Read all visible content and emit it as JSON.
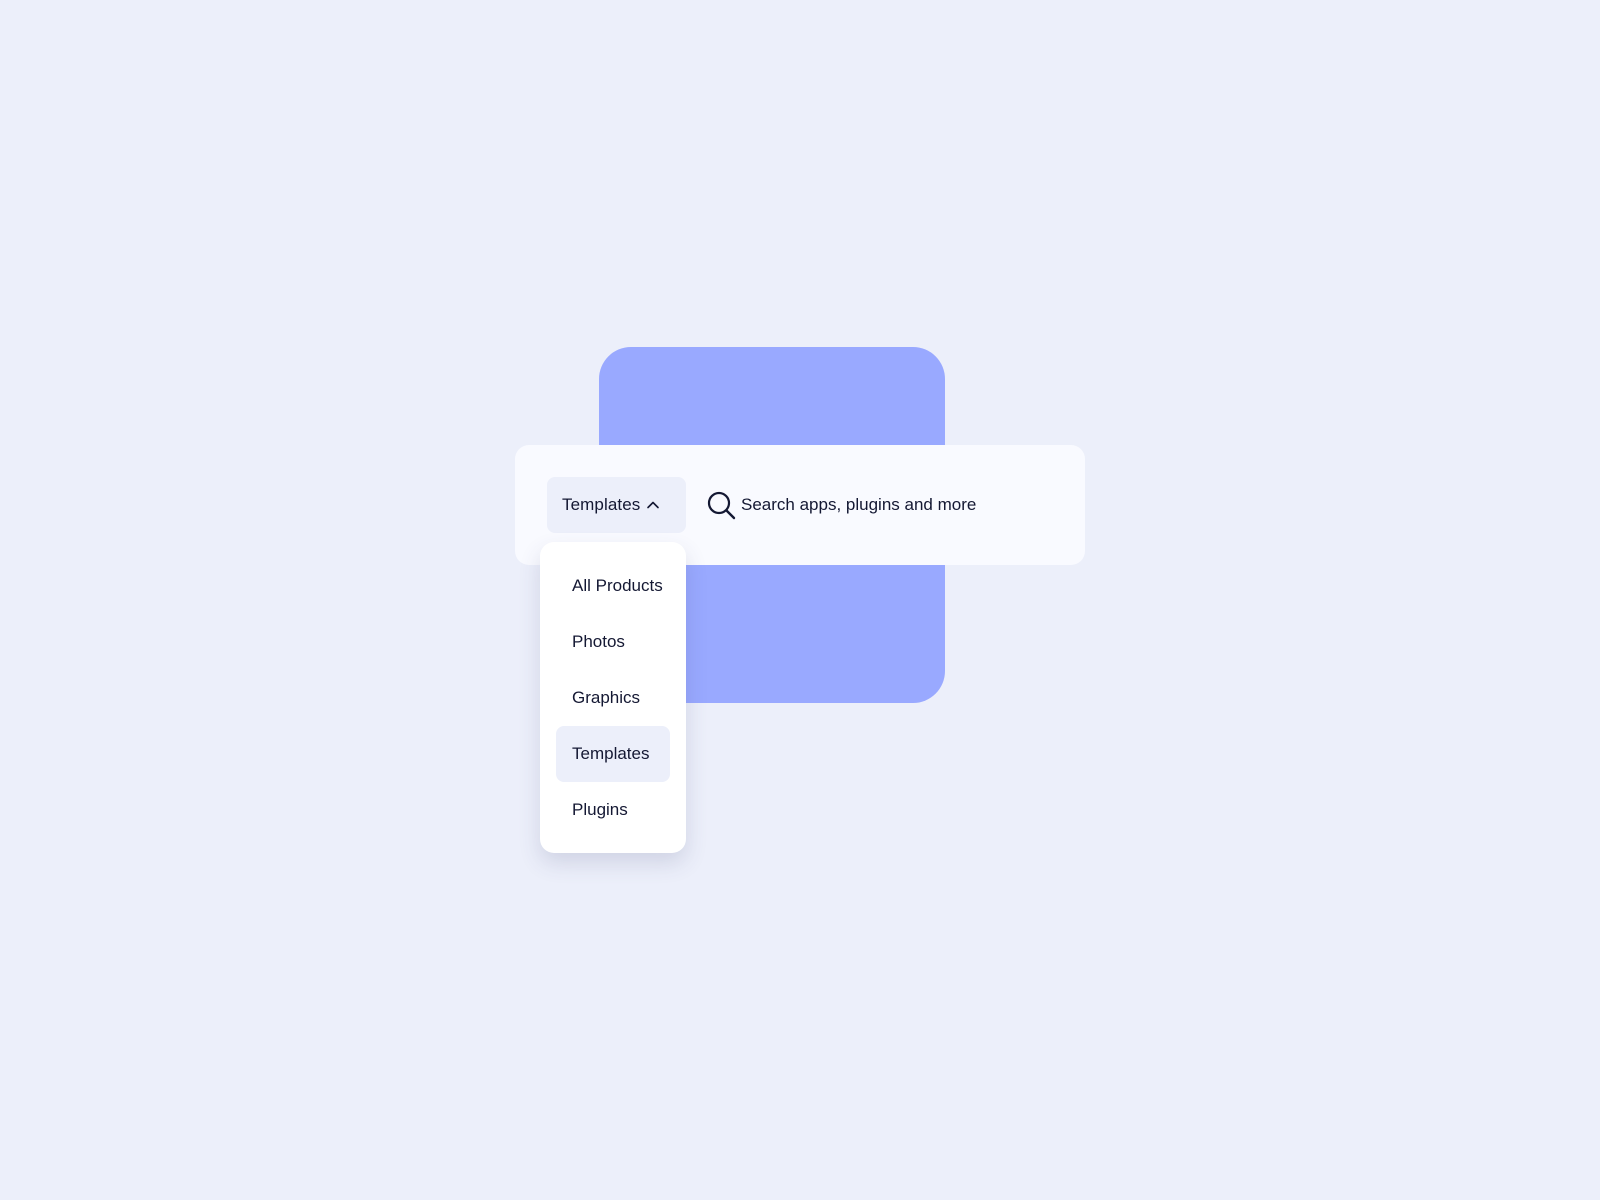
{
  "category_button": {
    "label": "Templates",
    "icon": "chevron-up-icon"
  },
  "search": {
    "placeholder": "Search apps, plugins and more",
    "icon": "search-icon"
  },
  "dropdown": {
    "items": [
      {
        "label": "All Products",
        "selected": false
      },
      {
        "label": "Photos",
        "selected": false
      },
      {
        "label": "Graphics",
        "selected": false
      },
      {
        "label": "Templates",
        "selected": true
      },
      {
        "label": "Plugins",
        "selected": false
      }
    ]
  },
  "colors": {
    "background": "#eceffa",
    "accent_block": "#99a9ff",
    "search_bar": "#f9faff",
    "menu_background": "#ffffff",
    "selected_item": "#eceffa",
    "text": "#141833"
  }
}
